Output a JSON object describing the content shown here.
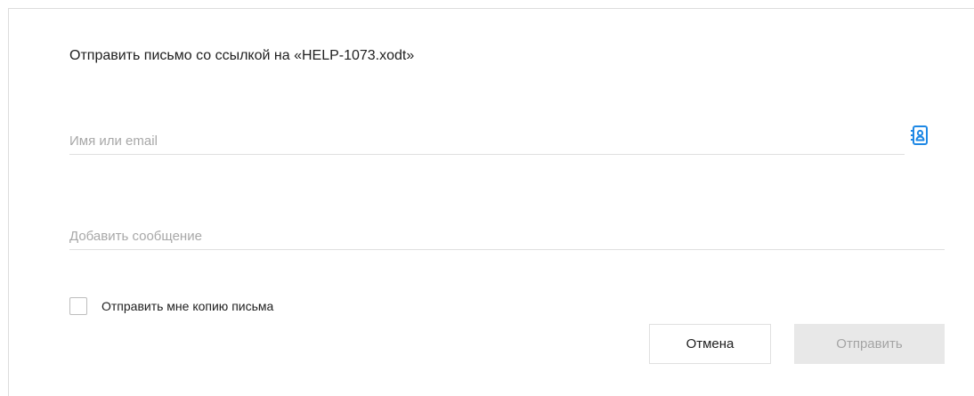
{
  "dialog": {
    "title": "Отправить письмо со ссылкой на «HELP-1073.xodt»",
    "recipient": {
      "value": "",
      "placeholder": "Имя или email"
    },
    "contacts_icon": "address-book-icon",
    "message": {
      "value": "",
      "placeholder": "Добавить сообщение"
    },
    "copy_checkbox": {
      "label": "Отправить мне копию письма",
      "checked": false
    },
    "buttons": {
      "cancel_label": "Отмена",
      "send_label": "Отправить",
      "send_enabled": false
    }
  },
  "colors": {
    "accent": "#1e88e5",
    "border": "#e0e0e0",
    "placeholder": "#a8a8a8",
    "disabled_bg": "#e8e8e8",
    "disabled_text": "#a4a4a4"
  }
}
